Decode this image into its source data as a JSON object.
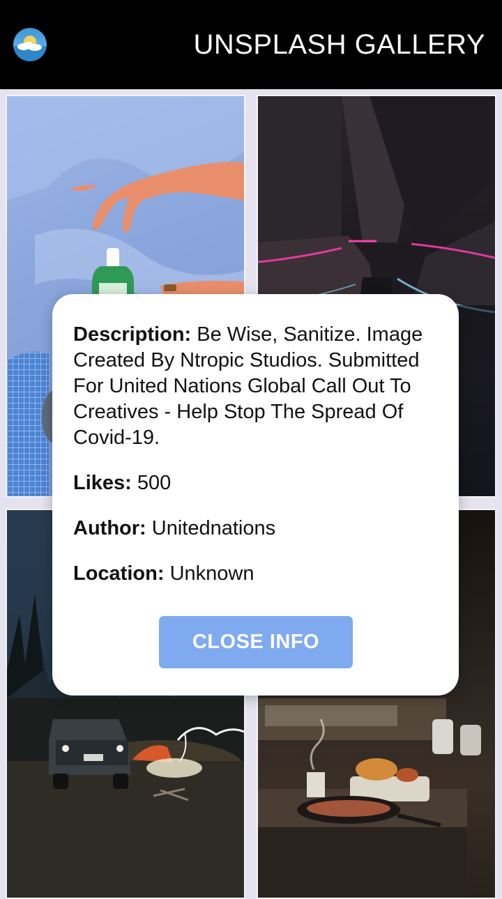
{
  "header": {
    "title": "UNSPLASH GALLERY",
    "logo_icon": "weather-sun-cloud-icon"
  },
  "gallery": {
    "photos": [
      {
        "subject": "hand-sanitizer-photo"
      },
      {
        "subject": "neon-tunnel-photo"
      },
      {
        "subject": "night-camping-photo"
      },
      {
        "subject": "rustic-kitchen-photo"
      }
    ]
  },
  "info_modal": {
    "description_label": "Description:",
    "description_value": "Be Wise, Sanitize. Image Created By Ntropic Studios. Submitted For United Nations Global Call Out To Creatives - Help Stop The Spread Of Covid-19.",
    "likes_label": "Likes:",
    "likes_value": "500",
    "author_label": "Author:",
    "author_value": "Unitednations",
    "location_label": "Location:",
    "location_value": "Unknown",
    "close_label": "CLOSE INFO"
  },
  "colors": {
    "header_bg": "#000000",
    "button_bg": "#7faaf0",
    "page_bg": "#e4e3ef"
  }
}
